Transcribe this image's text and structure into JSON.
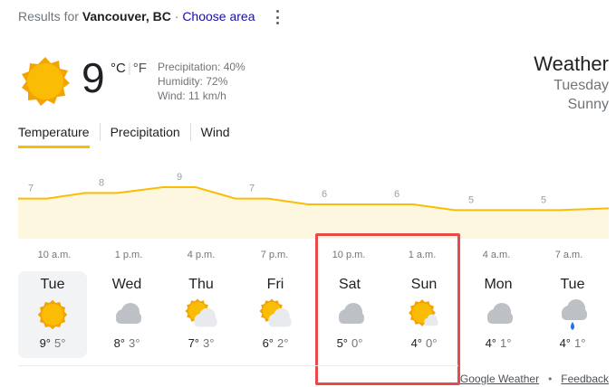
{
  "header": {
    "results_prefix": "Results for",
    "location": "Vancouver, BC",
    "separator": "·",
    "choose_area": "Choose area"
  },
  "current": {
    "temperature": "9",
    "unit_c": "°C",
    "unit_sep": "|",
    "unit_f": "°F",
    "precipitation": "Precipitation: 40%",
    "humidity": "Humidity: 72%",
    "wind": "Wind: 11 km/h",
    "icon": "sun-icon"
  },
  "side": {
    "title": "Weather",
    "day": "Tuesday",
    "condition": "Sunny"
  },
  "tabs": [
    {
      "label": "Temperature",
      "active": true
    },
    {
      "label": "Precipitation",
      "active": false
    },
    {
      "label": "Wind",
      "active": false
    }
  ],
  "chart_data": {
    "type": "area",
    "x": [
      "10 a.m.",
      "1 p.m.",
      "4 p.m.",
      "7 p.m.",
      "10 p.m.",
      "1 a.m.",
      "4 a.m.",
      "7 a.m."
    ],
    "values": [
      7,
      8,
      9,
      7,
      6,
      6,
      5,
      5
    ],
    "ylim": [
      0,
      12
    ],
    "fill_color": "#fef7e0",
    "line_color": "#fbbc04",
    "grid": false
  },
  "days": [
    {
      "name": "Tue",
      "icon": "sun-icon",
      "high": "9°",
      "low": "5°",
      "selected": true
    },
    {
      "name": "Wed",
      "icon": "cloud-icon",
      "high": "8°",
      "low": "3°",
      "selected": false
    },
    {
      "name": "Thu",
      "icon": "partly-cloudy-icon",
      "high": "7°",
      "low": "3°",
      "selected": false
    },
    {
      "name": "Fri",
      "icon": "partly-cloudy-icon",
      "high": "6°",
      "low": "2°",
      "selected": false
    },
    {
      "name": "Sat",
      "icon": "cloud-icon",
      "high": "5°",
      "low": "0°",
      "selected": false
    },
    {
      "name": "Sun",
      "icon": "mostly-sunny-icon",
      "high": "4°",
      "low": "0°",
      "selected": false
    },
    {
      "name": "Mon",
      "icon": "cloud-icon",
      "high": "4°",
      "low": "1°",
      "selected": false
    },
    {
      "name": "Tue",
      "icon": "rain-icon",
      "high": "4°",
      "low": "1°",
      "selected": false
    }
  ],
  "footer": {
    "source": "Google Weather",
    "separator": "•",
    "feedback": "Feedback"
  },
  "colors": {
    "sun": "#fbbc04",
    "sun_dark": "#f29900",
    "cloud": "#bdc1c6",
    "rain": "#1a73e8",
    "highlight": "#e84a4a"
  }
}
